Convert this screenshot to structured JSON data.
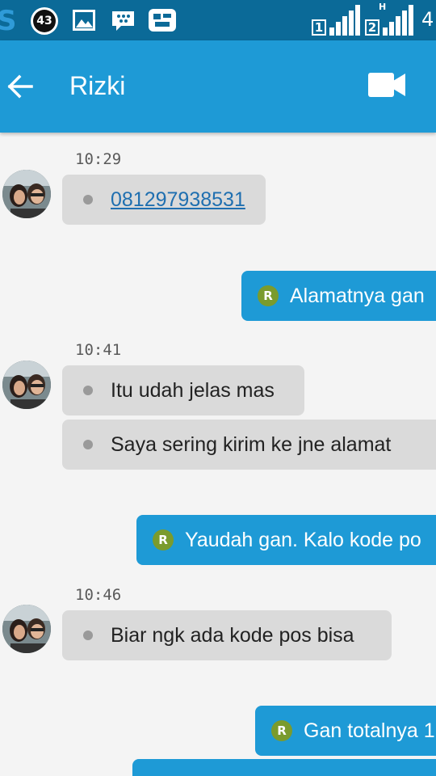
{
  "status_bar": {
    "notification_count": "43",
    "sim1_label": "1",
    "sim2_label": "2",
    "network_type": "H",
    "right_text": "4"
  },
  "header": {
    "title": "Rizki"
  },
  "messages": [
    {
      "time": "10:29",
      "text": "081297938531"
    },
    {
      "text": "Alamatnya gan"
    },
    {
      "time": "10:41",
      "text": "Itu udah jelas mas"
    },
    {
      "text": "Saya sering  kirim  ke jne  alamat"
    },
    {
      "text": "Yaudah gan. Kalo kode po"
    },
    {
      "time": "10:46",
      "text": "Biar ngk ada kode  pos  bisa"
    },
    {
      "text": "Gan totalnya 1"
    }
  ],
  "sent_badge_letter": "R"
}
